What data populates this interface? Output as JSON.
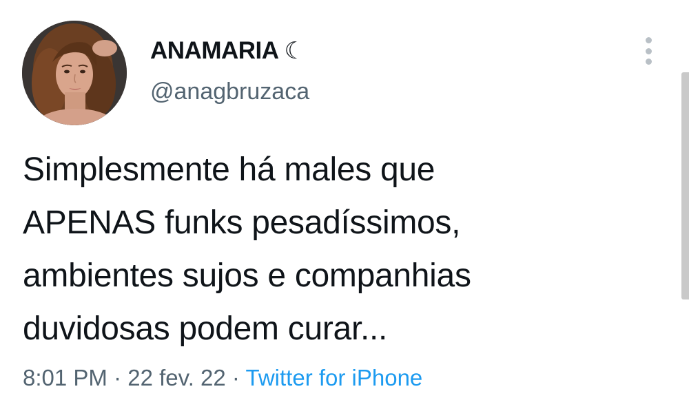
{
  "user": {
    "display_name": "ANAMARIA",
    "name_emoji": "☾",
    "handle": "@anagbruzaca",
    "avatar_icon": "profile-photo"
  },
  "tweet": {
    "lines": [
      "Simplesmente há males que",
      "APENAS funks pesadíssimos,",
      "ambientes sujos e companhias",
      "duvidosas podem curar..."
    ],
    "time": "8:01 PM",
    "date": "22 fev. 22",
    "separator": "·",
    "source": "Twitter for iPhone"
  },
  "colors": {
    "text": "#0f1419",
    "secondary": "#536471",
    "link": "#1d9bf0"
  }
}
